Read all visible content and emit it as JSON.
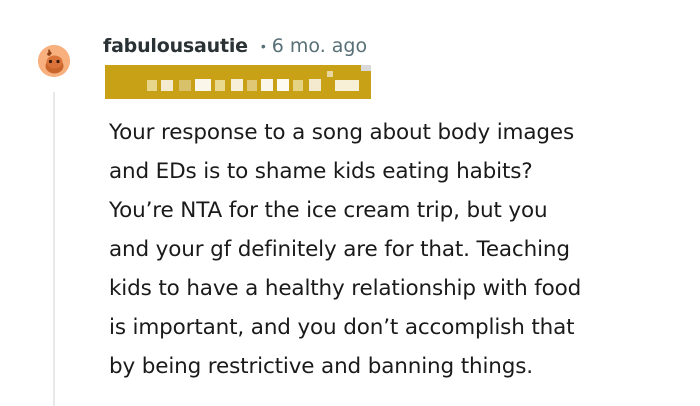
{
  "comment": {
    "author": "fabulousautie",
    "separator": "•",
    "timestamp": "6 mo. ago",
    "avatar_icon": "snoo-avatar-icon",
    "flair_icon": "redacted-flair",
    "accent_color": "#c8a11a",
    "body_lines": [
      "Your response to a song about body images",
      "and EDs is to shame kids eating habits?",
      "You’re NTA for the ice cream trip, but you",
      "and your gf definitely are for that. Teaching",
      "kids to have a healthy relationship with food",
      "is important, and you don’t accomplish that",
      "by being restrictive and banning things."
    ]
  }
}
